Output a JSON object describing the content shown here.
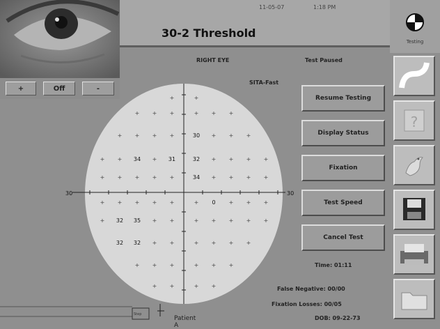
{
  "header": {
    "title": "30-2 Threshold",
    "date": "11-05-07",
    "time": "1:18 PM",
    "status_label": "Testing"
  },
  "camera": {
    "buttons": [
      "+",
      "Off",
      "-"
    ]
  },
  "test_info": {
    "eye": "RIGHT EYE",
    "state": "Test Paused",
    "strategy": "SITA-Fast"
  },
  "field": {
    "axis_labels": {
      "left": "30",
      "right": "30"
    },
    "values": [
      {
        "row": 2,
        "col": 5,
        "value": "30"
      },
      {
        "row": 3,
        "col": 2,
        "value": "34"
      },
      {
        "row": 3,
        "col": 4,
        "value": "31"
      },
      {
        "row": 3,
        "col": 5,
        "value": "32"
      },
      {
        "row": 4,
        "col": 5,
        "value": "34"
      },
      {
        "row": 5,
        "col": 6,
        "value": "0"
      },
      {
        "row": 6,
        "col": 1,
        "value": "32"
      },
      {
        "row": 6,
        "col": 2,
        "value": "35"
      },
      {
        "row": 7,
        "col": 1,
        "value": "32"
      },
      {
        "row": 7,
        "col": 2,
        "value": "32"
      }
    ]
  },
  "buttons": {
    "resume": "Resume Testing",
    "display": "Display Status",
    "fixation": "Fixation",
    "speed": "Test Speed",
    "cancel": "Cancel Test"
  },
  "stats": {
    "time": "Time: 01:11",
    "false_negative": "False Negative: 00/00",
    "fixation_losses": "Fixation Losses: 00/05",
    "dob": "DOB: 09-22-73"
  },
  "patient": {
    "name": "Patient A",
    "strip_label": "Step"
  },
  "colors": {
    "background": "#8f8f8f",
    "field": "#d8d8d8",
    "button": "#9c9c9c"
  }
}
